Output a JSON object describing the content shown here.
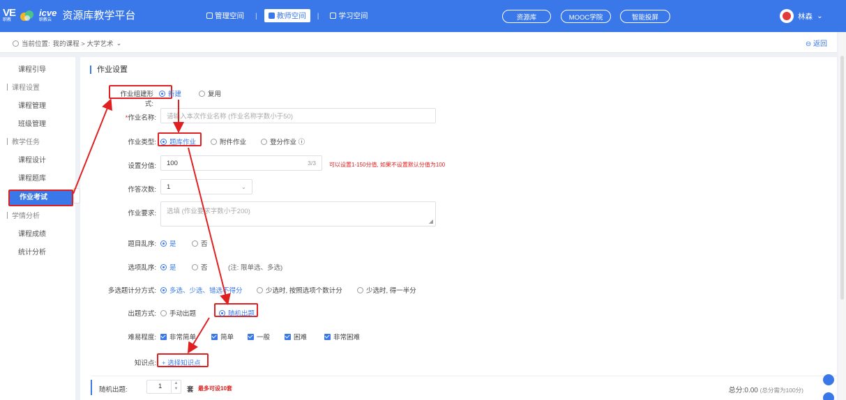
{
  "header": {
    "logo_ve": "VE",
    "logo_ve_sub": "职教",
    "logo_icve": "icve",
    "logo_icve_sub": "职教云",
    "app_title": "资源库教学平台",
    "tabs": [
      {
        "label": "管理空间"
      },
      {
        "label": "教师空间",
        "active": true
      },
      {
        "label": "学习空间"
      }
    ],
    "pills": [
      "资源库",
      "MOOC学院",
      "智能投屏"
    ],
    "user_name": "林森",
    "colors": {
      "primary": "#3a78ea",
      "annotation": "#e02020"
    }
  },
  "breadcrumb": {
    "prefix": "当前位置:",
    "path": "我的课程 > 大学艺术",
    "back": "返回"
  },
  "sidebar": {
    "items": [
      {
        "label": "课程引导",
        "type": "item"
      },
      {
        "label": "课程设置",
        "type": "group"
      },
      {
        "label": "课程管理",
        "type": "item"
      },
      {
        "label": "班级管理",
        "type": "item"
      },
      {
        "label": "教学任务",
        "type": "group"
      },
      {
        "label": "课程设计",
        "type": "item"
      },
      {
        "label": "课程题库",
        "type": "item"
      },
      {
        "label": "作业考试",
        "type": "item",
        "active": true
      },
      {
        "label": "学情分析",
        "type": "group"
      },
      {
        "label": "课程成绩",
        "type": "item"
      },
      {
        "label": "统计分析",
        "type": "item"
      }
    ]
  },
  "form": {
    "title": "作业设置",
    "create_mode": {
      "label": "作业组建形式:",
      "options": [
        "新建",
        "复用"
      ],
      "selected": "新建"
    },
    "name": {
      "label": "作业名称:",
      "required_mark": "*",
      "placeholder": "请输入本次作业名称 (作业名称字数小于50)"
    },
    "type": {
      "label": "作业类型:",
      "options": [
        "题库作业",
        "附件作业",
        "登分作业"
      ],
      "selected": "题库作业",
      "info": "ⓘ"
    },
    "score": {
      "label": "设置分值:",
      "value": "100",
      "counter": "3/3",
      "hint": "可以设置1-150分值, 如果不设置默认分值为100"
    },
    "attempts": {
      "label": "作答次数:",
      "value": "1"
    },
    "requirement": {
      "label": "作业要求:",
      "placeholder": "选填 (作业要求字数小于200)"
    },
    "question_shuffle": {
      "label": "题目乱序:",
      "options": [
        "是",
        "否"
      ],
      "selected": "是"
    },
    "option_shuffle": {
      "label": "选项乱序:",
      "options": [
        "是",
        "否"
      ],
      "selected": "是",
      "note": "(注: 限单选、多选)"
    },
    "multi_scoring": {
      "label": "多选题计分方式:",
      "options": [
        "多选、少选、错选不得分",
        "少选时, 按照选项个数计分",
        "少选时, 得一半分"
      ],
      "selected": "多选、少选、错选不得分"
    },
    "question_mode": {
      "label": "出题方式:",
      "options": [
        "手动出题",
        "随机出题"
      ],
      "selected": "随机出题"
    },
    "difficulty": {
      "label": "难易程度:",
      "options": [
        "非常简单",
        "简单",
        "一般",
        "困难",
        "非常困难"
      ]
    },
    "knowledge": {
      "label": "知识点:",
      "link": "+ 选择知识点"
    },
    "random": {
      "label": "随机出题:",
      "value": "1",
      "unit": "套",
      "hint": "最多可设10套"
    },
    "total": {
      "label": "总分:0.00",
      "note": "(总分需为100分)"
    }
  }
}
